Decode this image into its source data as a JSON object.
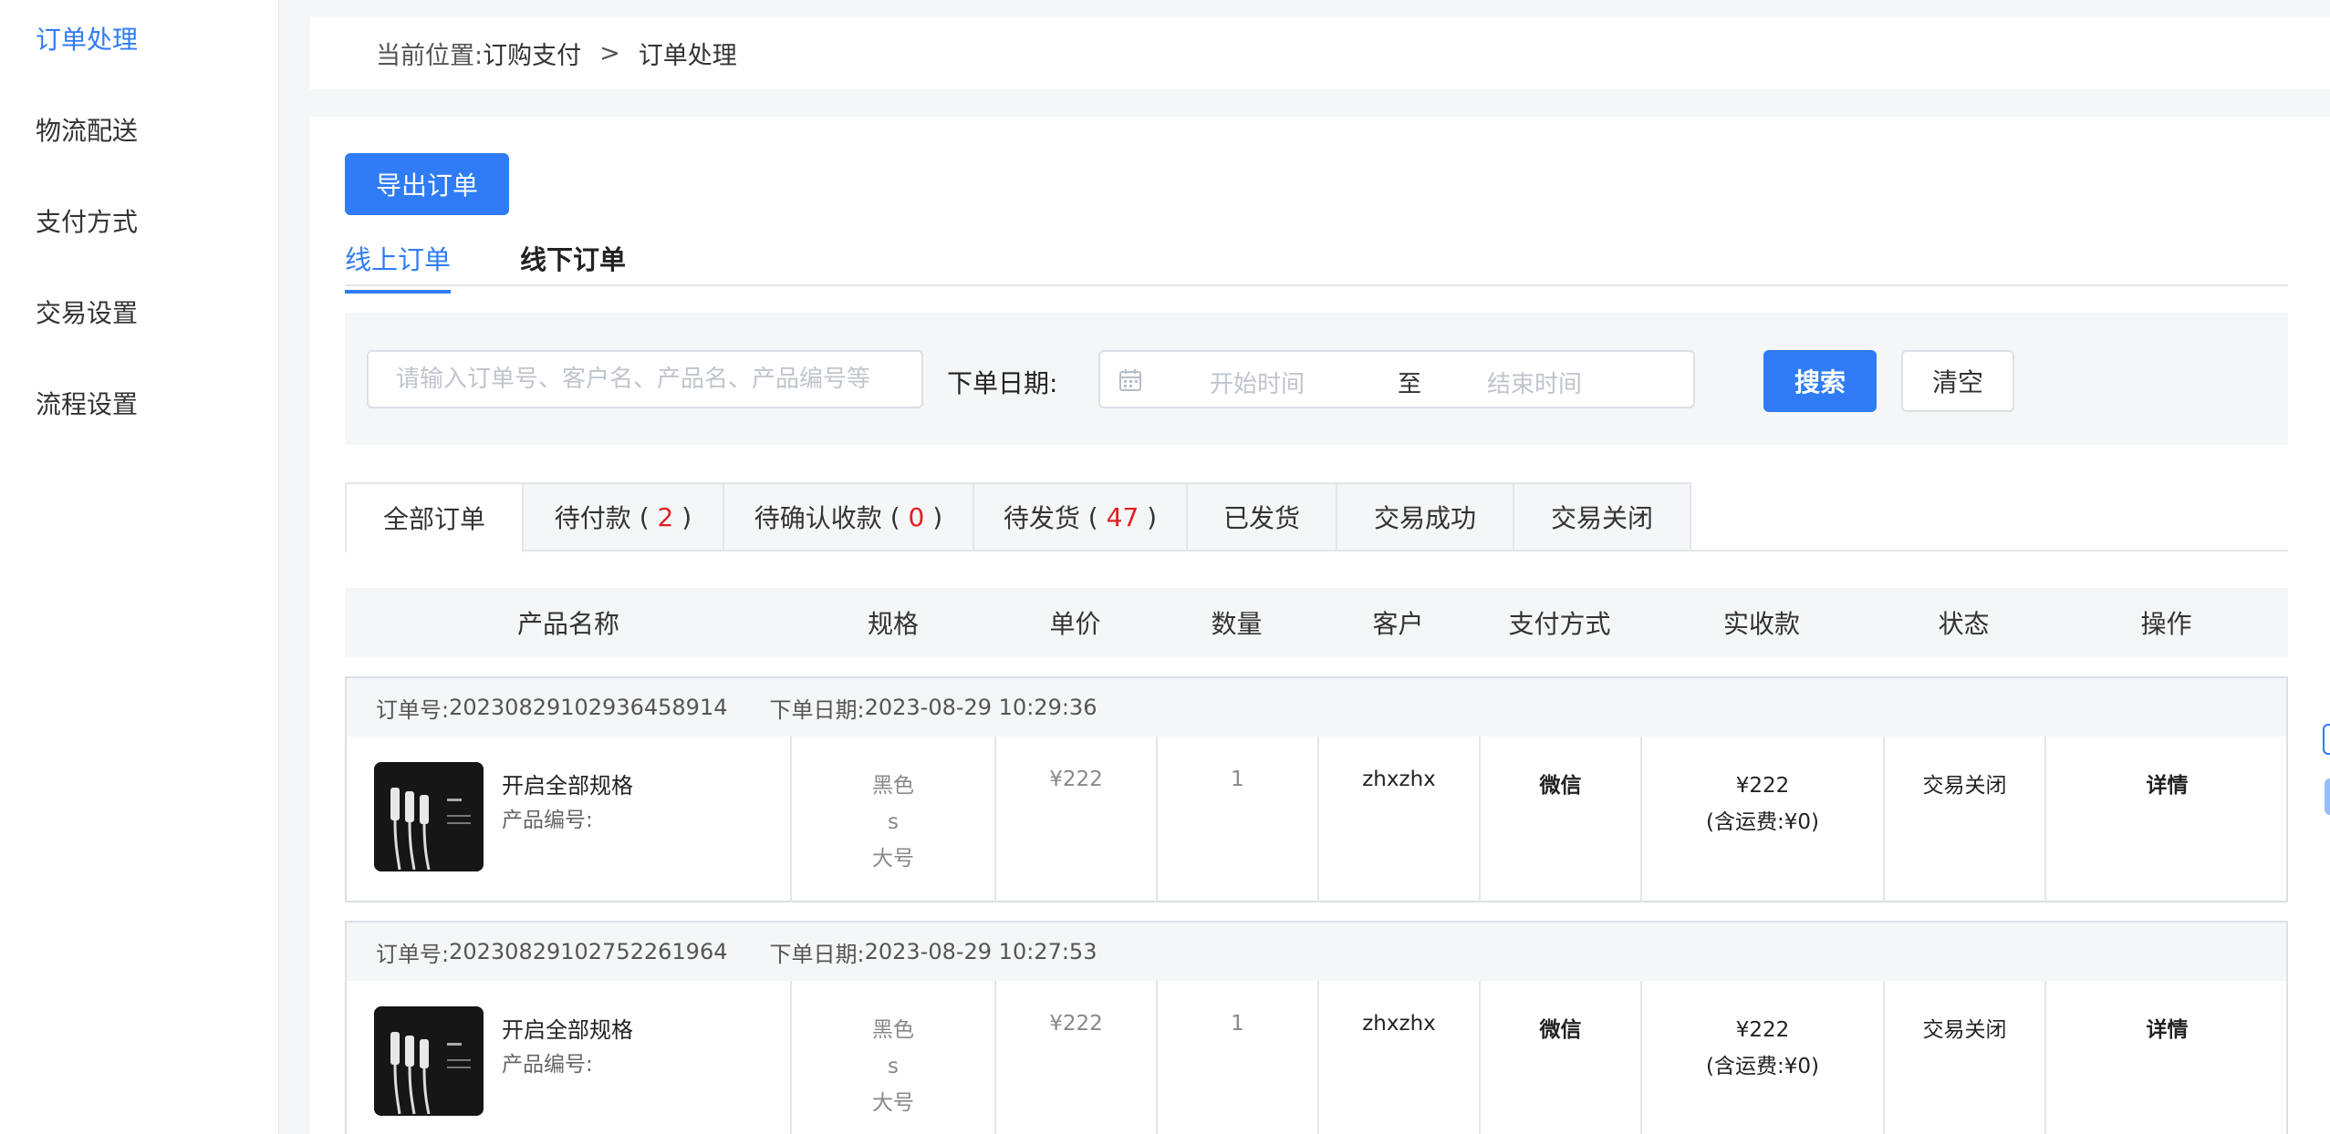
{
  "sidebar": {
    "items": [
      {
        "label": "订单处理",
        "active": true
      },
      {
        "label": "物流配送"
      },
      {
        "label": "支付方式"
      },
      {
        "label": "交易设置"
      },
      {
        "label": "流程设置"
      }
    ]
  },
  "breadcrumb": {
    "prefix": "当前位置:",
    "items": [
      "订购支付",
      "订单处理"
    ],
    "separator": ">"
  },
  "toolbar": {
    "export_label": "导出订单"
  },
  "order_type_tabs": [
    {
      "label": "线上订单",
      "active": true
    },
    {
      "label": "线下订单"
    }
  ],
  "filter": {
    "search_placeholder": "请输入订单号、客户名、产品名、产品编号等",
    "search_value": "",
    "date_label": "下单日期:",
    "start_placeholder": "开始时间",
    "range_separator": "至",
    "end_placeholder": "结束时间",
    "search_label": "搜索",
    "clear_label": "清空"
  },
  "status_tabs": [
    {
      "label": "全部订单",
      "active": true
    },
    {
      "label": "待付款",
      "count": "2"
    },
    {
      "label": "待确认收款",
      "count": "0"
    },
    {
      "label": "待发货",
      "count": "47"
    },
    {
      "label": "已发货"
    },
    {
      "label": "交易成功"
    },
    {
      "label": "交易关闭"
    }
  ],
  "table": {
    "columns": [
      "产品名称",
      "规格",
      "单价",
      "数量",
      "客户",
      "支付方式",
      "实收款",
      "状态",
      "操作"
    ],
    "orders": [
      {
        "order_no_label": "订单号:",
        "order_no": "20230829102936458914",
        "date_label": "下单日期:",
        "date": "2023-08-29 10:29:36",
        "product_name": "开启全部规格",
        "product_code_label": "产品编号:",
        "product_code": "",
        "specs": [
          "黑色",
          "s",
          "大号"
        ],
        "price": "¥222",
        "quantity": "1",
        "customer": "zhxzhx",
        "payment": "微信",
        "received": "¥222",
        "shipping_note": "(含运费:¥0)",
        "status": "交易关闭",
        "action": "详情"
      },
      {
        "order_no_label": "订单号:",
        "order_no": "20230829102752261964",
        "date_label": "下单日期:",
        "date": "2023-08-29 10:27:53",
        "product_name": "开启全部规格",
        "product_code_label": "产品编号:",
        "product_code": "",
        "specs": [
          "黑色",
          "s",
          "大号"
        ],
        "price": "¥222",
        "quantity": "1",
        "customer": "zhxzhx",
        "payment": "微信",
        "received": "¥222",
        "shipping_note": "(含运费:¥0)",
        "status": "交易关闭",
        "action": "详情"
      }
    ]
  },
  "colors": {
    "accent": "#2f7cf6",
    "count_highlight": "#e02020",
    "page_bg": "#f5f6f8"
  }
}
